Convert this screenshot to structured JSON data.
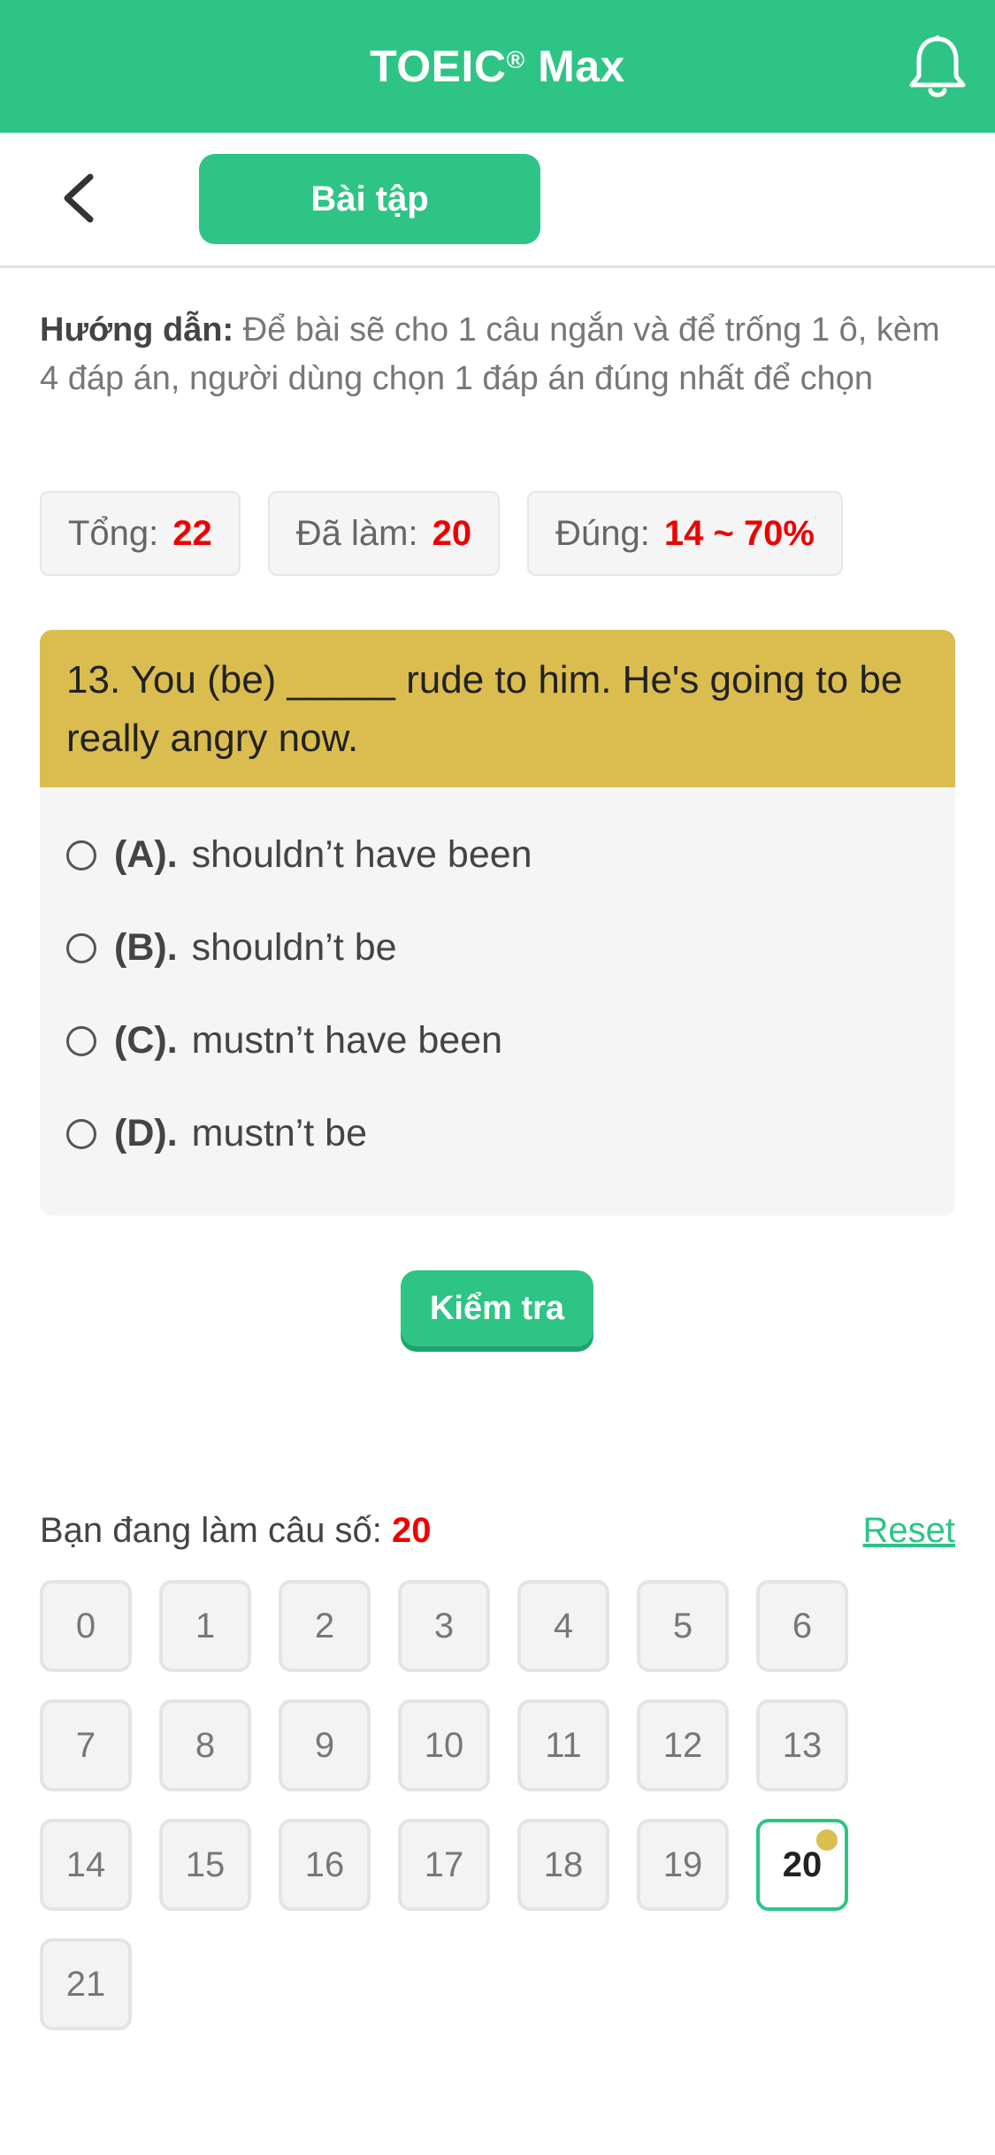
{
  "header": {
    "title": "TOEIC",
    "title_mark": "®",
    "title_suffix": " Max"
  },
  "subbar": {
    "tab_label": "Bài tập"
  },
  "guide": {
    "label": "Hướng dẫn:",
    "text": " Để bài sẽ cho 1 câu ngắn và để trống 1 ô, kèm 4 đáp án, người dùng chọn 1 đáp án đúng nhất để chọn"
  },
  "stats": {
    "total_label": "Tổng:",
    "total_value": "22",
    "done_label": "Đã làm:",
    "done_value": "20",
    "correct_label": "Đúng:",
    "correct_value": "14 ~ 70%"
  },
  "question": {
    "text": "13. You (be) _____ rude to him. He's going to be really angry now.",
    "options": [
      {
        "key": "(A).",
        "text": "shouldn’t have been"
      },
      {
        "key": "(B).",
        "text": "shouldn’t be"
      },
      {
        "key": "(C).",
        "text": "mustn’t have been"
      },
      {
        "key": "(D).",
        "text": "mustn’t be"
      }
    ]
  },
  "check_button": "Kiểm tra",
  "progress": {
    "label": "Bạn đang làm câu số: ",
    "current": "20",
    "reset": "Reset"
  },
  "grid": [
    "0",
    "1",
    "2",
    "3",
    "4",
    "5",
    "6",
    "7",
    "8",
    "9",
    "10",
    "11",
    "12",
    "13",
    "14",
    "15",
    "16",
    "17",
    "18",
    "19",
    "20",
    "21"
  ],
  "colors": {
    "brand": "#2ec485",
    "question_bg": "#dbbd4f",
    "highlight_red": "#e00000"
  },
  "icons": {
    "notification": "bell-icon",
    "back": "chevron-left-icon"
  }
}
